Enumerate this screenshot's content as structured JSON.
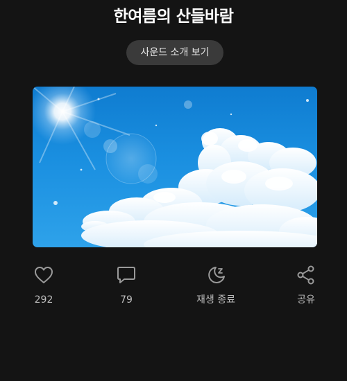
{
  "title": "한여름의 산들바람",
  "intro_button": "사운드 소개 보기",
  "actions": {
    "like_count": "292",
    "comment_count": "79",
    "sleep_timer_label": "재생 종료",
    "share_label": "공유"
  },
  "colors": {
    "background": "#141414",
    "button_bg": "#3a3a3a",
    "icon": "#9a9a9a",
    "sky": "#1a8fe0"
  },
  "icons": {
    "like": "heart-icon",
    "comment": "comment-icon",
    "sleep": "moon-sleep-icon",
    "share": "share-icon"
  }
}
